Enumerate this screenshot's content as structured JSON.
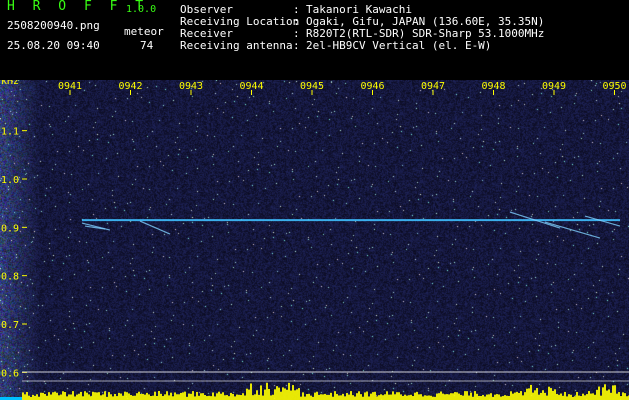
{
  "header": {
    "app_title": "H R O F F T",
    "app_version": "1.0.0",
    "filename": "2508200940.png",
    "datetime": "25.08.20 09:40",
    "meteor_label": "meteor",
    "meteor_count": "74"
  },
  "info": [
    {
      "key": "Observer",
      "value": "Takanori Kawachi"
    },
    {
      "key": "Receiving Location",
      "value": "Ogaki, Gifu, JAPAN (136.60E, 35.35N)"
    },
    {
      "key": "Receiver",
      "value": "R820T2(RTL-SDR) SDR-Sharp 53.1000MHz"
    },
    {
      "key": "Receiving antenna",
      "value": "2el-HB9CV Vertical (el. E-W)"
    }
  ],
  "chart_data": {
    "type": "heatmap",
    "ylabel": "kHz",
    "x_ticks": [
      "0941",
      "0942",
      "0943",
      "0944",
      "0945",
      "0946",
      "0947",
      "0948",
      "0949",
      "0950"
    ],
    "y_ticks": [
      "1.1",
      "1.0",
      "0.9",
      "0.8",
      "0.7",
      "0.6"
    ],
    "ylim": [
      0.58,
      1.18
    ],
    "carrier_khz": 0.915,
    "colors": {
      "background": "#0a0a2a",
      "labels": "#ffff00",
      "carrier": "#40c0ff",
      "level": "#ffff00"
    }
  }
}
